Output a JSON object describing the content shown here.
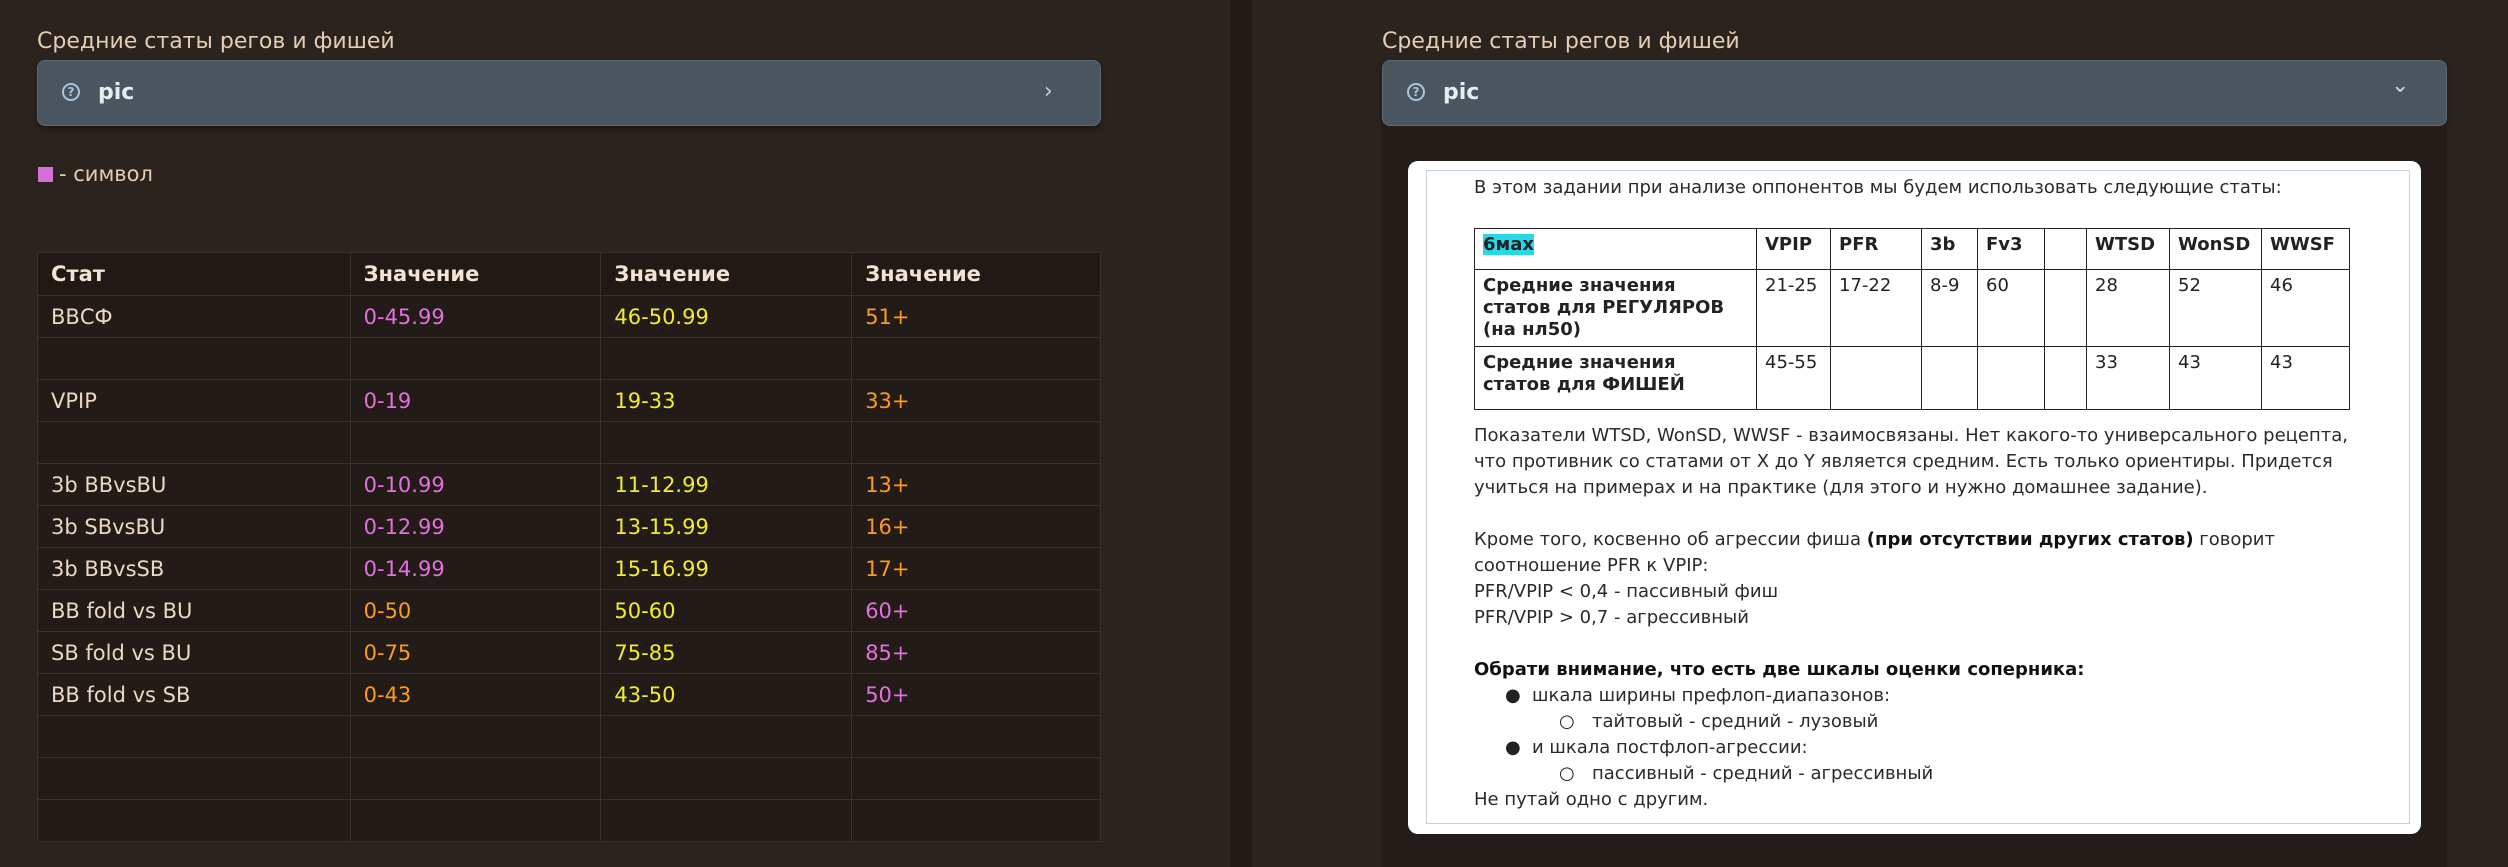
{
  "left": {
    "heading": "Средние статы регов и фишей",
    "callout_title": "pic",
    "callout_chevron": "›",
    "legend_text": "- символ",
    "legend_color": "#d66fd7",
    "table": {
      "headers": [
        "Стат",
        "Значение",
        "Значение",
        "Значение"
      ],
      "rows": [
        [
          "ВВСФ",
          "0-45.99",
          "46-50.99",
          "51+"
        ],
        [
          "",
          "",
          "",
          ""
        ],
        [
          "VPIP",
          "0-19",
          "19-33",
          "33+"
        ],
        [
          "",
          "",
          "",
          ""
        ],
        [
          "3b BBvsBU",
          "0-10.99",
          "11-12.99",
          "13+"
        ],
        [
          "3b SBvsBU",
          "0-12.99",
          "13-15.99",
          "16+"
        ],
        [
          "3b BBvsSB",
          "0-14.99",
          "15-16.99",
          "17+"
        ],
        [
          "BB fold vs BU",
          "0-50",
          "50-60",
          "60+"
        ],
        [
          "SB fold vs BU",
          "0-75",
          "75-85",
          "85+"
        ],
        [
          "BB fold vs SB",
          "0-43",
          "43-50",
          "50+"
        ],
        [
          "",
          "",
          "",
          ""
        ],
        [
          "",
          "",
          "",
          ""
        ],
        [
          "",
          "",
          "",
          ""
        ]
      ],
      "colors": {
        "pink": "#e56fe0",
        "yellow": "#f2ec2f",
        "orange": "#ff9a1f"
      }
    }
  },
  "right": {
    "heading": "Средние статы регов и фишей",
    "callout_title": "pic",
    "callout_chevron": "⌄",
    "doc": {
      "intro": "В этом задании при анализе оппонентов мы будем использовать следующие статы:",
      "ref_table": {
        "header": [
          "6мах",
          "VPIP",
          "PFR",
          "3b",
          "Fv3",
          "",
          "WTSD",
          "WonSD",
          "WWSF"
        ],
        "rows": [
          [
            "Средние значения статов для РЕГУЛЯРОВ (на нл50)",
            "21-25",
            "17-22",
            "8-9",
            "60",
            "",
            "28",
            "52",
            "46"
          ],
          [
            "Средние значения статов для ФИШЕЙ",
            "45-55",
            "",
            "",
            "",
            "",
            "33",
            "43",
            "43"
          ]
        ]
      },
      "p1_l1": "Показатели WTSD, WonSD, WWSF - взаимосвязаны. Нет какого-то универсального рецепта,",
      "p1_l2": "что противник со статами от X до Y является средним. Есть только ориентиры. Придется",
      "p1_l3": "учиться на примерах и на практике (для этого и нужно домашнее задание).",
      "p2_l1a": "Кроме того, косвенно об агрессии фиша ",
      "p2_l1b": "(при отсутствии других статов)",
      "p2_l1c": " говорит",
      "p2_l2": "соотношение PFR к VPIP:",
      "p2_l3": "PFR/VPIP < 0,4 - пассивный фиш",
      "p2_l4": "PFR/VPIP > 0,7 - агрессивный",
      "attention": "Обрати внимание, что есть две шкалы оценки соперника:",
      "bullet1": "шкала ширины префлоп-диапазонов:",
      "sub1": "тайтовый - средний - лузовый",
      "bullet2": "и шкала постфлоп-агрессии:",
      "sub2": "пассивный - средний - агрессивный",
      "closing": "Не путай одно с другим."
    }
  }
}
